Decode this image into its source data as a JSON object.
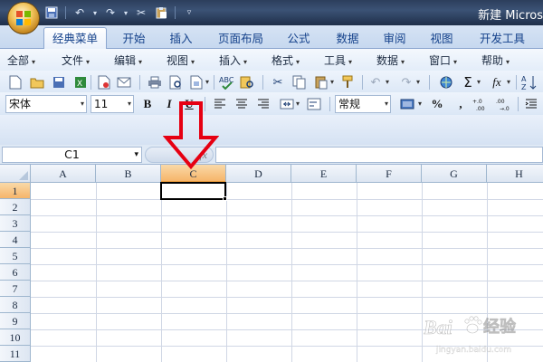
{
  "window": {
    "title": "新建 Micros"
  },
  "tabs": [
    {
      "label": "经典菜单",
      "active": true
    },
    {
      "label": "开始"
    },
    {
      "label": "插入"
    },
    {
      "label": "页面布局"
    },
    {
      "label": "公式"
    },
    {
      "label": "数据"
    },
    {
      "label": "审阅"
    },
    {
      "label": "视图"
    },
    {
      "label": "开发工具"
    }
  ],
  "menus": [
    "全部",
    "文件",
    "编辑",
    "视图",
    "插入",
    "格式",
    "工具",
    "数据",
    "窗口",
    "帮助"
  ],
  "toolbar": {
    "font_name": "宋体",
    "font_size": "11",
    "bold": "B",
    "italic": "I",
    "underline": "U",
    "number_format": "常规",
    "percent": "%",
    "comma": ",",
    "increase_decimal": "+.0\n.00",
    "decrease_decimal": ".00\n→.0",
    "sum": "Σ",
    "function": "fx"
  },
  "formula_bar": {
    "name_box": "C1",
    "fx_label": "fx",
    "value": ""
  },
  "sheet": {
    "columns": [
      "A",
      "B",
      "C",
      "D",
      "E",
      "F",
      "G",
      "H"
    ],
    "rows": [
      "1",
      "2",
      "3",
      "4",
      "5",
      "6",
      "7",
      "8",
      "9",
      "10",
      "11"
    ],
    "selected_column": "C",
    "selected_row": "1",
    "active_cell": "C1"
  },
  "colors": {
    "selection_header": "#f6b56a",
    "annotation_arrow": "#e60012",
    "ribbon_bg": "#dfe9f5"
  },
  "watermark": {
    "brand": "Baidu",
    "text": "经验",
    "url": "jingyan.baidu.com"
  }
}
